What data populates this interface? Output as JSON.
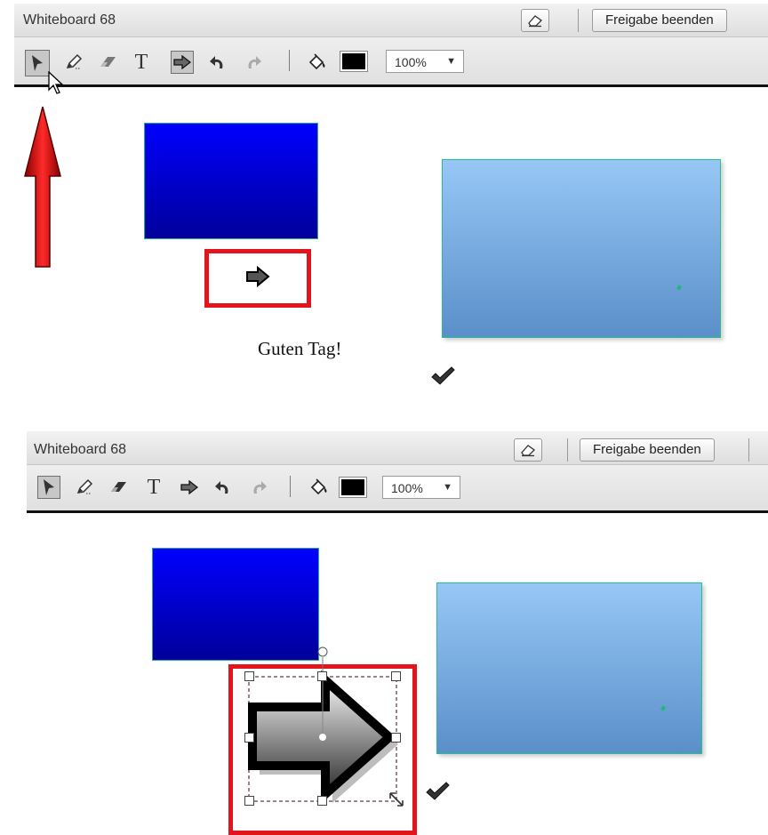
{
  "colors": {
    "accent_red": "#e3141c",
    "dark_rect": "#0000ff",
    "light_rect": "#96c7f6",
    "selected_color": "#000000"
  },
  "panels": [
    {
      "title": "Whiteboard 68",
      "clear_icon": "eraser-page-icon",
      "end_share_label": "Freigabe beenden",
      "tools": [
        {
          "name": "select-tool",
          "icon": "pointer-arrow-icon",
          "active": true
        },
        {
          "name": "pencil-tool",
          "icon": "pencil-icon",
          "active": false
        },
        {
          "name": "eraser-tool",
          "icon": "eraser-icon",
          "active": false
        },
        {
          "name": "text-tool",
          "icon": "text-T-icon",
          "active": false
        },
        {
          "name": "arrow-tool",
          "icon": "arrow-shape-icon",
          "active": true
        },
        {
          "name": "undo",
          "icon": "undo-icon",
          "active": false
        },
        {
          "name": "redo",
          "icon": "redo-icon",
          "active": false
        }
      ],
      "fill_icon": "paint-bucket-icon",
      "zoom": "100%",
      "text_label": "Guten Tag!"
    },
    {
      "title": "Whiteboard 68",
      "clear_icon": "eraser-page-icon",
      "end_share_label": "Freigabe beenden",
      "tools": [
        {
          "name": "select-tool",
          "icon": "pointer-arrow-icon",
          "active": true
        },
        {
          "name": "pencil-tool",
          "icon": "pencil-icon",
          "active": false
        },
        {
          "name": "eraser-tool",
          "icon": "eraser-icon",
          "active": false
        },
        {
          "name": "text-tool",
          "icon": "text-T-icon",
          "active": false
        },
        {
          "name": "arrow-tool",
          "icon": "arrow-shape-icon",
          "active": false
        },
        {
          "name": "undo",
          "icon": "undo-icon",
          "active": false
        },
        {
          "name": "redo",
          "icon": "redo-icon",
          "active": false
        }
      ],
      "fill_icon": "paint-bucket-icon",
      "zoom": "100%"
    }
  ]
}
